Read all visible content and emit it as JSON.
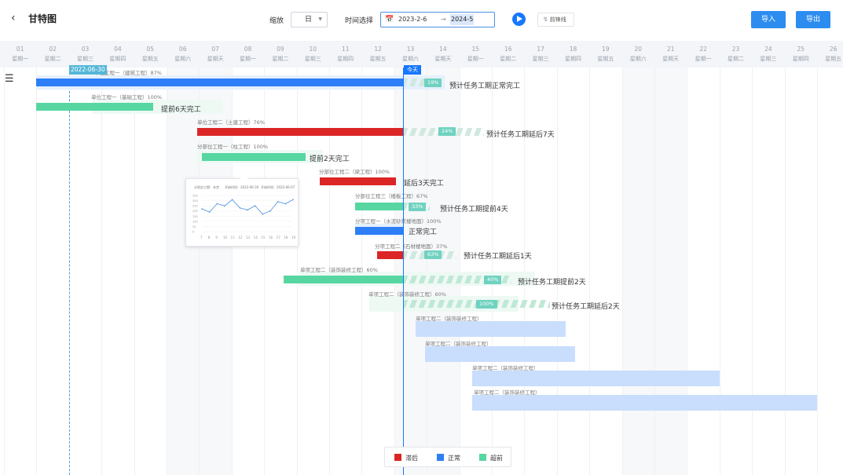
{
  "page": {
    "title": "甘特图",
    "back_icon": "chevron-left-icon"
  },
  "toolbar": {
    "zoom_label": "缩放",
    "zoom_value": "日",
    "time_label": "时间选择",
    "range_start": "2023-2-6",
    "range_sep": "→",
    "range_end": "2024-5",
    "front_line_label": "前锋线",
    "import_label": "导入",
    "export_label": "导出"
  },
  "days": [
    {
      "d": "01",
      "w": "星期一"
    },
    {
      "d": "02",
      "w": "星期二"
    },
    {
      "d": "03",
      "w": "星期三"
    },
    {
      "d": "04",
      "w": "星期四"
    },
    {
      "d": "05",
      "w": "星期五"
    },
    {
      "d": "06",
      "w": "星期六"
    },
    {
      "d": "07",
      "w": "星期天"
    },
    {
      "d": "08",
      "w": "星期一"
    },
    {
      "d": "09",
      "w": "星期二"
    },
    {
      "d": "10",
      "w": "星期三"
    },
    {
      "d": "11",
      "w": "星期四"
    },
    {
      "d": "12",
      "w": "星期五"
    },
    {
      "d": "13",
      "w": "星期六"
    },
    {
      "d": "14",
      "w": "星期天"
    },
    {
      "d": "15",
      "w": "星期一"
    },
    {
      "d": "16",
      "w": "星期二"
    },
    {
      "d": "17",
      "w": "星期三"
    },
    {
      "d": "18",
      "w": "星期四"
    },
    {
      "d": "19",
      "w": "星期五"
    },
    {
      "d": "20",
      "w": "星期六"
    },
    {
      "d": "21",
      "w": "星期天"
    },
    {
      "d": "22",
      "w": "星期一"
    },
    {
      "d": "23",
      "w": "星期二"
    },
    {
      "d": "24",
      "w": "星期三"
    },
    {
      "d": "25",
      "w": "星期四"
    },
    {
      "d": "26",
      "w": "星期五"
    }
  ],
  "markers": {
    "date_tag": "2022-06-30",
    "today_tag": "今天"
  },
  "tasks": [
    {
      "label": "单位工程一（建筑工程）87%",
      "pct": "19%",
      "note": "预计任务工期正常完工",
      "status": "normal"
    },
    {
      "label": "单位工程一（基础工程）100%",
      "note": "提前6天完工",
      "status": "ahead"
    },
    {
      "label": "单位工程二（土建工程）76%",
      "pct": "24%",
      "note": "预计任务工期延后7天",
      "status": "delayed"
    },
    {
      "label": "分部位工程一（柱工程）100%",
      "note": "提前2天完工",
      "status": "ahead"
    },
    {
      "label": "分部位工程二（梁工程）100%",
      "note": "延后3天完工",
      "status": "delayed"
    },
    {
      "label": "分部位工程三（楼板工程）67%",
      "pct": "33%",
      "note": "预计任务工期提前4天",
      "status": "ahead"
    },
    {
      "label": "分项工程一（水泥砂浆楼地面）100%",
      "note": "正常完工",
      "status": "normal"
    },
    {
      "label": "分项工程二（石材楼地面）37%",
      "pct": "63%",
      "note": "预计任务工期延后1天",
      "status": "delayed"
    },
    {
      "label": "单项工程二（装饰装修工程）60%",
      "pct": "40%",
      "note": "预计任务工期提前2天",
      "status": "ahead"
    },
    {
      "label": "单项工程二（装饰装修工程）60%",
      "pct": "100%",
      "note": "预计任务工期延后2天",
      "status": "ahead"
    },
    {
      "label": "单项工程二（装饰装修工程）",
      "status": "planned"
    },
    {
      "label": "单项工程二（装饰装修工程）",
      "status": "planned"
    },
    {
      "label": "单项工程二（装饰装修工程）",
      "status": "planned"
    },
    {
      "label": "单项工程二（装饰装修工程）",
      "status": "planned"
    }
  ],
  "popup": {
    "plan_label": "计划总工期：未完",
    "start_label": "开始时间：2022-06-30",
    "end_label": "开始时间：2022-06-07",
    "y_ticks": [
      "350",
      "300",
      "250",
      "200",
      "150",
      "100",
      "50",
      "0"
    ],
    "x_ticks": [
      "7",
      "8",
      "9",
      "10",
      "11",
      "12",
      "13",
      "14",
      "15",
      "16",
      "17",
      "18",
      "19"
    ],
    "line_values": [
      220,
      190,
      270,
      250,
      310,
      230,
      210,
      250,
      170,
      200,
      290,
      270,
      310
    ]
  },
  "legend": {
    "delayed": "滞后",
    "normal": "正常",
    "ahead": "超前",
    "colors": {
      "delayed": "#dc2525",
      "normal": "#2d7ef7",
      "ahead": "#57d6a2"
    }
  }
}
